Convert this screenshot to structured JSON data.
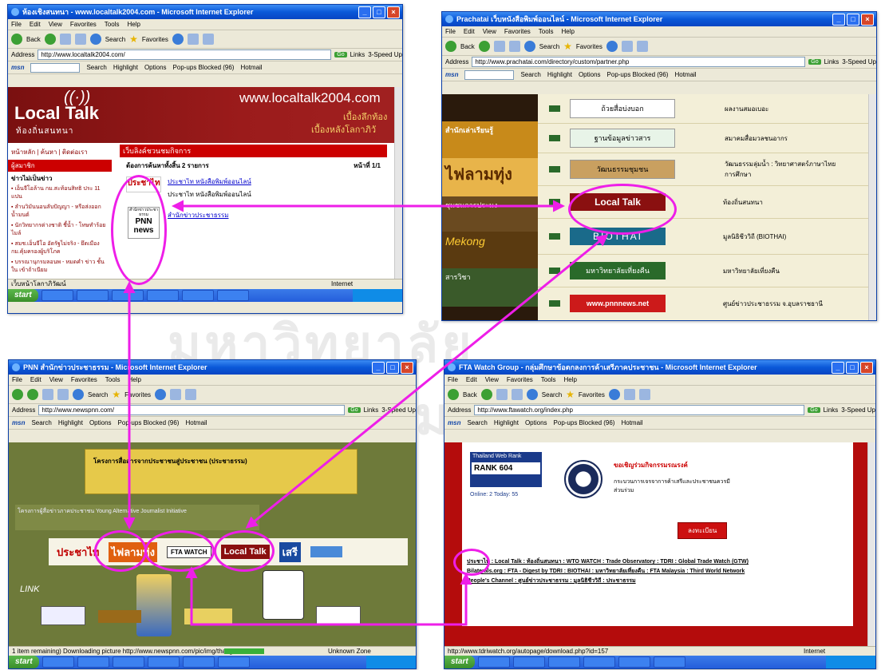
{
  "watermark": "มหาวิทยาลัย",
  "common": {
    "menu": [
      "File",
      "Edit",
      "View",
      "Favorites",
      "Tools",
      "Help"
    ],
    "toolbar_back": "Back",
    "toolbar_search": "Search",
    "toolbar_favorites": "Favorites",
    "address_label": "Address",
    "go_label": "Go",
    "links_label": "Links",
    "speedup_label": "3-Speed Up",
    "msn_logo": "msn",
    "msn_search": "Search",
    "msn_highlight": "Highlight",
    "msn_options": "Options",
    "msn_popups": "Pop-ups Blocked (96)",
    "msn_hotmail": "Hotmail",
    "start_label": "start",
    "status_internet": "Internet"
  },
  "win1": {
    "title": "ห้องเชิงสนทนา - www.localtalk2004.com - Microsoft Internet Explorer",
    "address": "http://www.localtalk2004.com/",
    "banner_logo": "Local Talk",
    "banner_logo_thai": "ท้องถิ่นสนทนา",
    "banner_url": "www.localtalk2004.com",
    "banner_tag1": "เบื้องลึกท้อง",
    "banner_tag2": "เบื้องหลังโลกาภิวั",
    "nav": "หน้าหลัก | ค้นหา | ติดต่อเรา",
    "side_header": "ผู้สมาชิก",
    "side_sub": "ข่าวไม่เป็นข่าว",
    "side_items": [
      "เอ็นจีโอล้าน กม.สะท้อนสิทธิ ประ 11 แปน",
      "ลำนวิมันนอนลับปัญญา - หรือส่งออกน้ำมนต์",
      "นักวิทยากรต่างชาติ ชี้น้ำ - โทษทำร้อยไมล์",
      "สมช.เอ็นจีโอ อัดรัฐไม่จริง - ยึดเมือง กม.คุ้มครองผู้บริโภค",
      "บรรณานุกรมลอนพ - หมดคำ ข่าว ชั้นใน เข้าถ้าเนียม"
    ],
    "section_title": "เว็บลิงค์ชวนชมกิจการ",
    "count_line": "ต้องการค้นหาทั้งสิ้น 2 รายการ",
    "page_line": "หน้าที่ 1/1",
    "link1": "ประชาไท หนังสือพิมพ์ออนไลน์",
    "link1_desc": "ประชาไท หนังสือพิมพ์ออนไลน์",
    "link2": "สำนักข่าวประชาธรรม",
    "logo1": "ประชาไท",
    "logo2_top": "สำนักข่าวประชาธรรม",
    "logo2": "PNN news",
    "status_left": "เว็บหน้าโลกาภิวัฒน์"
  },
  "win2": {
    "title": "Prachatai เว็บหนังสือพิมพ์ออนไลน์ - Microsoft Internet Explorer",
    "address": "http://www.prachatai.com/directory/custom/partner.php",
    "left_labels": [
      "สำนักเล่าเรียนรู้",
      "ไฟลามทุ่ง",
      "ชุมชนการประมง",
      "Mekong",
      "สารวิชา"
    ],
    "rows": [
      {
        "banner": "ถ้วยสื่อบ่งบอก",
        "desc": "ผลงานสมอเบอะ"
      },
      {
        "banner": "ฐานข้อมูลข่าวสาร",
        "desc": "สมาคมสื่อมวลชนอากร"
      },
      {
        "banner": "วัฒนธรรมชุมชน",
        "desc": "วัฒนธรรมลุ่มน้ำ : วิทยาศาสตร์ภาษาไทยการศึกษา"
      },
      {
        "banner": "Local Talk",
        "desc": "ท้องถิ่นสนทนา"
      },
      {
        "banner": "BIOTHAI",
        "desc": "มูลนิธิชีววิถี (BIOTHAI)"
      },
      {
        "banner": "มหาวิทยาลัยเที่ยงคืน",
        "desc": "มหาวิทยาลัยเที่ยงคืน"
      },
      {
        "banner": "www.pnnnews.net",
        "desc": "ศูนย์ข่าวประชาธรรม จ.อุบลราชธานี"
      }
    ]
  },
  "win3": {
    "title": "PNN สำนักข่าวประชาธรรม - Microsoft Internet Explorer",
    "address": "http://www.newspnn.com/",
    "notice": "โครงการสื่อสารจากประชาชนสู่ประชาชน (ประชาธรรม)",
    "notice2": "โครงการผู้สื่อข่าวภาคประชาชน Young Alternative Journalist Initiative",
    "links_label": "LINK",
    "partners": [
      "ประชาไท",
      "ไฟลามทุ่ง",
      "FTA WATCH",
      "Local Talk",
      "เสรี"
    ],
    "status_left": "1 item remaining) Downloading picture http://www.newspnn.com/pic/img/thai.gif",
    "status_zone": "Unknown Zone"
  },
  "win4": {
    "title": "FTA Watch Group - กลุ่มศึกษาข้อตกลงการค้าเสรีภาคประชาชน - Microsoft Internet Explorer",
    "address": "http://www.ftawatch.org/index.php",
    "rank_label": "Thailand Web Rank",
    "rank": "RANK 604",
    "stats": "Online: 2 Today: 55",
    "heading": "ขอเชิญร่วมกิจกรรมรณรงค์",
    "desc": "กระบวนการเจรจาการค้าเสรีและประชาชนควรมีส่วนร่วม",
    "button": "ลงทะเบียน",
    "links_line1": "ประชาไท : Local Talk : ท้องถิ่นสนทนา : WTO WATCH : Trade Observatory : TDRI : Global Trade Watch (GTW)",
    "links_line2": "Bilaterals.org : FTA - Digest by TDRI : BIOTHAI : มหาวิทยาลัยเที่ยงคืน : FTA Malaysia : Third World Network",
    "links_line3": "People's Channel : ศูนย์ข่าวประชาธรรม : มูลนิธิชีววิถี : ประชาธรรม",
    "status_left": "http://www.tdriwatch.org/autopage/download.php?id=157"
  }
}
